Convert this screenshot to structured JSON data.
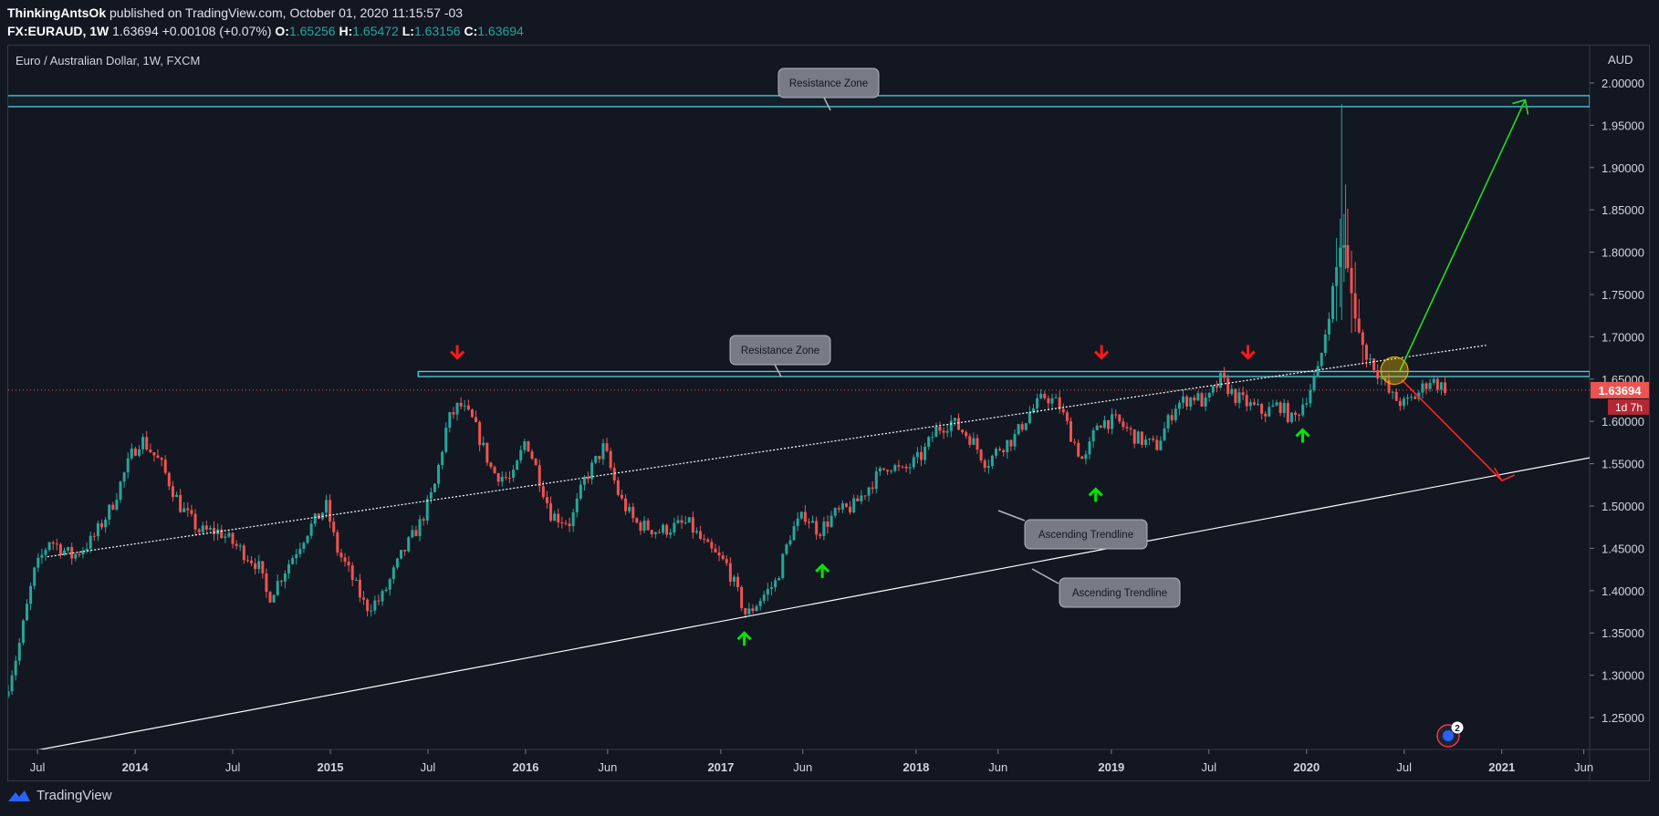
{
  "publisher": {
    "author": "ThinkingAntsOk",
    "text": "published on TradingView.com, October 01, 2020 11:15:57 -03"
  },
  "ticker": {
    "symbol": "FX:EURAUD, 1W",
    "last": "1.63694",
    "change": "+0.00108 (+0.07%)",
    "o_label": "O:",
    "o": "1.65256",
    "h_label": "H:",
    "h": "1.65472",
    "l_label": "L:",
    "l": "1.63156",
    "c_label": "C:",
    "c": "1.63694"
  },
  "colors": {
    "background": "#131722",
    "up": "#26a69a",
    "down": "#ef5350",
    "zone": "#4dd0e1",
    "trend": "#ffffff",
    "arrow_up": "#00e600",
    "arrow_down": "#ff1a1a",
    "price_tag": "#ef5350"
  },
  "chart_data": {
    "type": "candlestick",
    "title": "Euro / Australian Dollar, 1W, FXCM",
    "currency_label": "AUD",
    "ylim": [
      1.205,
      2.05
    ],
    "y_ticks": [
      "1.25000",
      "1.30000",
      "1.35000",
      "1.40000",
      "1.45000",
      "1.50000",
      "1.55000",
      "1.60000",
      "1.65000",
      "1.70000",
      "1.75000",
      "1.80000",
      "1.85000",
      "1.90000",
      "1.95000",
      "2.00000"
    ],
    "x_ticks": [
      "Jul",
      "2014",
      "Jul",
      "2015",
      "Jul",
      "2016",
      "Jun",
      "2017",
      "Jun",
      "2018",
      "Jun",
      "2019",
      "Jul",
      "2020",
      "Jul",
      "2021",
      "Jun"
    ],
    "x_tick_dates": [
      2013.5,
      2014.0,
      2014.5,
      2015.0,
      2015.5,
      2016.0,
      2016.42,
      2017.0,
      2017.42,
      2018.0,
      2018.42,
      2019.0,
      2019.5,
      2020.0,
      2020.5,
      2021.0,
      2021.42
    ],
    "xlim": [
      2013.35,
      2021.45
    ],
    "price_points": [
      [
        2013.35,
        1.275
      ],
      [
        2013.42,
        1.33
      ],
      [
        2013.5,
        1.42
      ],
      [
        2013.58,
        1.46
      ],
      [
        2013.7,
        1.44
      ],
      [
        2013.8,
        1.46
      ],
      [
        2013.9,
        1.5
      ],
      [
        2014.0,
        1.56
      ],
      [
        2014.05,
        1.58
      ],
      [
        2014.15,
        1.55
      ],
      [
        2014.25,
        1.5
      ],
      [
        2014.35,
        1.47
      ],
      [
        2014.45,
        1.47
      ],
      [
        2014.55,
        1.45
      ],
      [
        2014.65,
        1.43
      ],
      [
        2014.7,
        1.39
      ],
      [
        2014.8,
        1.43
      ],
      [
        2014.9,
        1.47
      ],
      [
        2015.0,
        1.5
      ],
      [
        2015.05,
        1.45
      ],
      [
        2015.12,
        1.42
      ],
      [
        2015.2,
        1.38
      ],
      [
        2015.28,
        1.39
      ],
      [
        2015.38,
        1.44
      ],
      [
        2015.48,
        1.48
      ],
      [
        2015.55,
        1.52
      ],
      [
        2015.62,
        1.6
      ],
      [
        2015.68,
        1.62
      ],
      [
        2015.75,
        1.6
      ],
      [
        2015.85,
        1.54
      ],
      [
        2015.95,
        1.53
      ],
      [
        2016.02,
        1.58
      ],
      [
        2016.08,
        1.54
      ],
      [
        2016.15,
        1.49
      ],
      [
        2016.25,
        1.48
      ],
      [
        2016.32,
        1.53
      ],
      [
        2016.42,
        1.57
      ],
      [
        2016.5,
        1.51
      ],
      [
        2016.58,
        1.48
      ],
      [
        2016.7,
        1.47
      ],
      [
        2016.85,
        1.48
      ],
      [
        2016.95,
        1.45
      ],
      [
        2017.05,
        1.43
      ],
      [
        2017.15,
        1.37
      ],
      [
        2017.22,
        1.39
      ],
      [
        2017.3,
        1.41
      ],
      [
        2017.38,
        1.47
      ],
      [
        2017.45,
        1.49
      ],
      [
        2017.52,
        1.47
      ],
      [
        2017.6,
        1.49
      ],
      [
        2017.7,
        1.5
      ],
      [
        2017.8,
        1.53
      ],
      [
        2017.88,
        1.55
      ],
      [
        2017.95,
        1.54
      ],
      [
        2018.05,
        1.56
      ],
      [
        2018.12,
        1.59
      ],
      [
        2018.2,
        1.6
      ],
      [
        2018.3,
        1.58
      ],
      [
        2018.38,
        1.55
      ],
      [
        2018.45,
        1.57
      ],
      [
        2018.52,
        1.58
      ],
      [
        2018.6,
        1.61
      ],
      [
        2018.68,
        1.63
      ],
      [
        2018.75,
        1.62
      ],
      [
        2018.82,
        1.58
      ],
      [
        2018.88,
        1.55
      ],
      [
        2018.95,
        1.6
      ],
      [
        2019.05,
        1.6
      ],
      [
        2019.15,
        1.58
      ],
      [
        2019.25,
        1.57
      ],
      [
        2019.35,
        1.62
      ],
      [
        2019.45,
        1.63
      ],
      [
        2019.5,
        1.62
      ],
      [
        2019.58,
        1.65
      ],
      [
        2019.65,
        1.63
      ],
      [
        2019.72,
        1.62
      ],
      [
        2019.8,
        1.61
      ],
      [
        2019.88,
        1.62
      ],
      [
        2019.95,
        1.6
      ],
      [
        2020.02,
        1.63
      ],
      [
        2020.08,
        1.66
      ],
      [
        2020.15,
        1.75
      ],
      [
        2020.2,
        1.82
      ],
      [
        2020.25,
        1.75
      ],
      [
        2020.3,
        1.69
      ],
      [
        2020.38,
        1.66
      ],
      [
        2020.45,
        1.63
      ],
      [
        2020.52,
        1.62
      ],
      [
        2020.58,
        1.63
      ],
      [
        2020.65,
        1.65
      ],
      [
        2020.72,
        1.64
      ]
    ],
    "current_price": "1.63694",
    "countdown": "1d 7h",
    "resistance_zones": [
      {
        "label": "Resistance Zone",
        "low": 1.972,
        "high": 1.985
      },
      {
        "label": "Resistance Zone",
        "low": 1.653,
        "high": 1.659
      }
    ],
    "trendlines": [
      {
        "label": "Ascending Trendline",
        "from": [
          2013.55,
          1.44
        ],
        "to": [
          2020.92,
          1.69
        ]
      },
      {
        "label": "Ascending Trendline",
        "from": [
          2013.35,
          1.205
        ],
        "to": [
          2021.45,
          1.557
        ]
      }
    ],
    "projections": [
      {
        "direction": "up",
        "to": [
          2021.12,
          1.98
        ]
      },
      {
        "direction": "down",
        "to": [
          2021.0,
          1.53
        ]
      }
    ],
    "down_markers": [
      [
        2015.65,
        1.66
      ],
      [
        2018.95,
        1.66
      ],
      [
        2019.7,
        1.66
      ]
    ],
    "up_markers": [
      [
        2017.12,
        1.35
      ],
      [
        2017.52,
        1.43
      ],
      [
        2018.92,
        1.52
      ],
      [
        2019.98,
        1.59
      ]
    ],
    "watch_point": [
      2020.45,
      1.66
    ],
    "badge_count": "2"
  },
  "branding": {
    "name": "TradingView"
  }
}
